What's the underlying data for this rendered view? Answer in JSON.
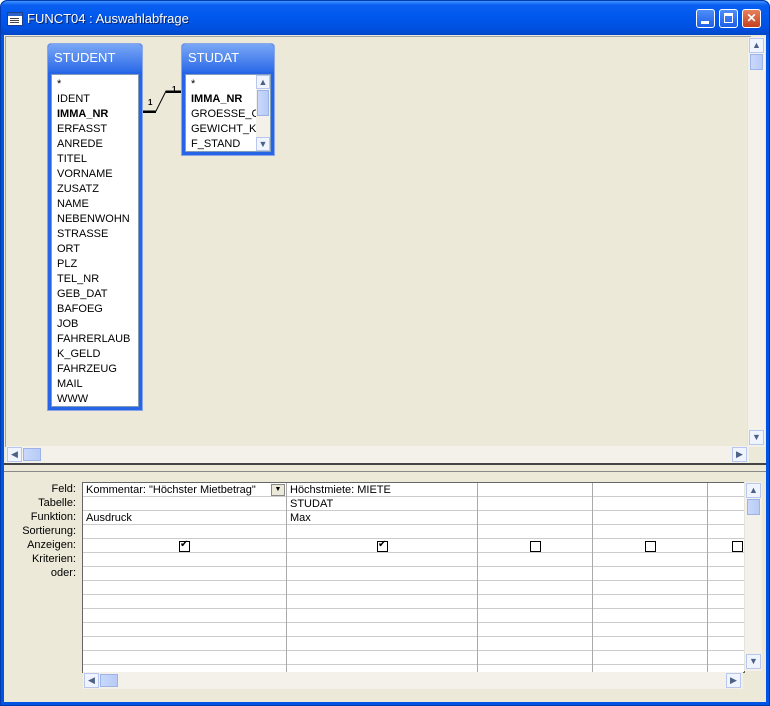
{
  "window": {
    "title": "FUNCT04 : Auswahlabfrage"
  },
  "tables": [
    {
      "name": "STUDENT",
      "fields": [
        "*",
        "IDENT",
        "IMMA_NR",
        "ERFASST",
        "ANREDE",
        "TITEL",
        "VORNAME",
        "ZUSATZ",
        "NAME",
        "NEBENWOHN",
        "STRASSE",
        "ORT",
        "PLZ",
        "TEL_NR",
        "GEB_DAT",
        "BAFOEG",
        "JOB",
        "FAHRERLAUB",
        "K_GELD",
        "FAHRZEUG",
        "MAIL",
        "WWW"
      ],
      "bold_field": "IMMA_NR"
    },
    {
      "name": "STUDAT",
      "fields": [
        "*",
        "IMMA_NR",
        "GROESSE_CM",
        "GEWICHT_KG",
        "F_STAND"
      ],
      "bold_field": "IMMA_NR"
    }
  ],
  "relation": {
    "left_label": "1",
    "right_label": "1"
  },
  "grid": {
    "row_labels": [
      "Feld:",
      "Tabelle:",
      "Funktion:",
      "Sortierung:",
      "Anzeigen:",
      "Kriterien:",
      "oder:"
    ],
    "columns": [
      {
        "feld": "Kommentar: \"Höchster Mietbetrag\"",
        "tabelle": "",
        "funktion": "Ausdruck",
        "anzeigen": true
      },
      {
        "feld": "Höchstmiete: MIETE",
        "tabelle": "STUDAT",
        "funktion": "Max",
        "anzeigen": true
      },
      {
        "feld": "",
        "tabelle": "",
        "funktion": "",
        "anzeigen": false
      },
      {
        "feld": "",
        "tabelle": "",
        "funktion": "",
        "anzeigen": false
      },
      {
        "feld": "",
        "tabelle": "",
        "funktion": "",
        "anzeigen": false
      }
    ]
  },
  "icons": {
    "window": "query-window-icon",
    "minimize": "minimize-icon",
    "maximize": "maximize-icon",
    "close": "close-icon"
  },
  "colors": {
    "titlebar": "#0058ee",
    "table_header": "#2b6ae8",
    "client": "#ece9d8"
  }
}
